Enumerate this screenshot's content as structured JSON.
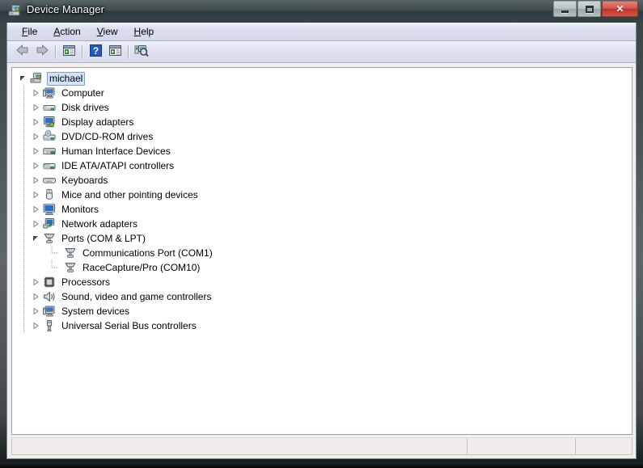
{
  "window": {
    "title": "Device Manager",
    "icon": "device-manager-icon",
    "controls": {
      "minimize_label": "Minimize",
      "maximize_label": "Maximize",
      "close_label": "Close",
      "close_glyph": "✕",
      "close_color": "#bc3528"
    }
  },
  "menubar": {
    "items": [
      {
        "label": "File",
        "accesskey": "F"
      },
      {
        "label": "Action",
        "accesskey": "A"
      },
      {
        "label": "View",
        "accesskey": "V"
      },
      {
        "label": "Help",
        "accesskey": "H"
      }
    ]
  },
  "toolbar": {
    "buttons": [
      {
        "name": "back-button",
        "icon": "back-arrow-icon",
        "tooltip": "Back"
      },
      {
        "name": "forward-button",
        "icon": "forward-arrow-icon",
        "tooltip": "Forward"
      },
      {
        "name": "show-hide-console-tree-button",
        "icon": "console-tree-icon",
        "tooltip": "Show/Hide Console Tree"
      },
      {
        "name": "help-button",
        "icon": "question-mark-icon",
        "tooltip": "Help"
      },
      {
        "name": "properties-button",
        "icon": "properties-icon",
        "tooltip": "Properties"
      },
      {
        "name": "scan-for-hardware-changes-button",
        "icon": "scan-hardware-icon",
        "tooltip": "Scan for hardware changes"
      }
    ]
  },
  "tree": {
    "root": {
      "label": "michael",
      "icon": "computer-node-icon",
      "selected": true,
      "expanded": true
    },
    "nodes": [
      {
        "label": "Computer",
        "icon": "computer-icon",
        "expanded": false,
        "depth": 1
      },
      {
        "label": "Disk drives",
        "icon": "disk-drive-icon",
        "expanded": false,
        "depth": 1
      },
      {
        "label": "Display adapters",
        "icon": "display-adapter-icon",
        "expanded": false,
        "depth": 1
      },
      {
        "label": "DVD/CD-ROM drives",
        "icon": "dvd-drive-icon",
        "expanded": false,
        "depth": 1
      },
      {
        "label": "Human Interface Devices",
        "icon": "hid-icon",
        "expanded": false,
        "depth": 1
      },
      {
        "label": "IDE ATA/ATAPI controllers",
        "icon": "ide-controller-icon",
        "expanded": false,
        "depth": 1
      },
      {
        "label": "Keyboards",
        "icon": "keyboard-icon",
        "expanded": false,
        "depth": 1
      },
      {
        "label": "Mice and other pointing devices",
        "icon": "mouse-icon",
        "expanded": false,
        "depth": 1
      },
      {
        "label": "Monitors",
        "icon": "monitor-icon",
        "expanded": false,
        "depth": 1
      },
      {
        "label": "Network adapters",
        "icon": "network-adapter-icon",
        "expanded": false,
        "depth": 1
      },
      {
        "label": "Ports (COM & LPT)",
        "icon": "port-icon",
        "expanded": true,
        "depth": 1
      },
      {
        "label": "Communications Port (COM1)",
        "icon": "port-icon",
        "expanded": null,
        "depth": 2
      },
      {
        "label": "RaceCapture/Pro (COM10)",
        "icon": "port-icon",
        "expanded": null,
        "depth": 2
      },
      {
        "label": "Processors",
        "icon": "processor-icon",
        "expanded": false,
        "depth": 1
      },
      {
        "label": "Sound, video and game controllers",
        "icon": "sound-icon",
        "expanded": false,
        "depth": 1
      },
      {
        "label": "System devices",
        "icon": "system-device-icon",
        "expanded": false,
        "depth": 1
      },
      {
        "label": "Universal Serial Bus controllers",
        "icon": "usb-icon",
        "expanded": false,
        "depth": 1
      }
    ]
  },
  "statusbar": {
    "panes": [
      "",
      "",
      ""
    ]
  }
}
